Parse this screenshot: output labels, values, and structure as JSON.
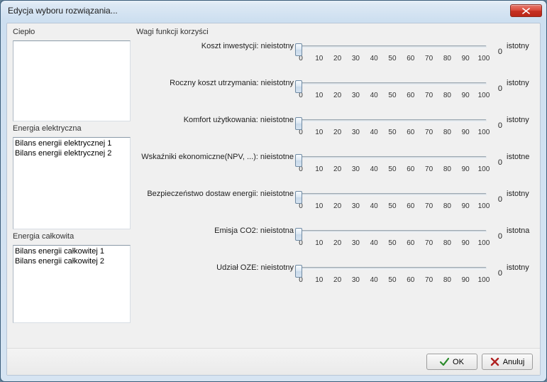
{
  "window": {
    "title": "Edycja wyboru rozwiązania..."
  },
  "left": {
    "heat_label": "Ciepło",
    "heat_items": [],
    "elec_label": "Energia elektryczna",
    "elec_items": [
      "Bilans energii elektrycznej 1",
      "Bilans energii elektrycznej 2"
    ],
    "total_label": "Energia całkowita",
    "total_items": [
      "Bilans energii całkowitej 1",
      "Bilans energii całkowitej 2"
    ]
  },
  "right": {
    "groupbox": "Wagi funkcji korzyści",
    "ticks": [
      "0",
      "10",
      "20",
      "30",
      "40",
      "50",
      "60",
      "70",
      "80",
      "90",
      "100"
    ],
    "rows": [
      {
        "label": "Koszt inwestycji: nieistotny",
        "rlabel": "istotny",
        "value": "0"
      },
      {
        "label": "Roczny koszt utrzymania: nieistotny",
        "rlabel": "istotny",
        "value": "0"
      },
      {
        "label": "Komfort użytkowania: nieistotne",
        "rlabel": "istotny",
        "value": "0"
      },
      {
        "label": "Wskaźniki ekonomiczne(NPV, ...): nieistotne",
        "rlabel": "istotne",
        "value": "0"
      },
      {
        "label": "Bezpieczeństwo dostaw energii: nieistotne",
        "rlabel": "istotny",
        "value": "0"
      },
      {
        "label": "Emisja CO2: nieistotna",
        "rlabel": "istotna",
        "value": "0"
      },
      {
        "label": "Udział OZE: nieistotny",
        "rlabel": "istotny",
        "value": "0"
      }
    ]
  },
  "buttons": {
    "ok": "OK",
    "cancel": "Anuluj"
  }
}
